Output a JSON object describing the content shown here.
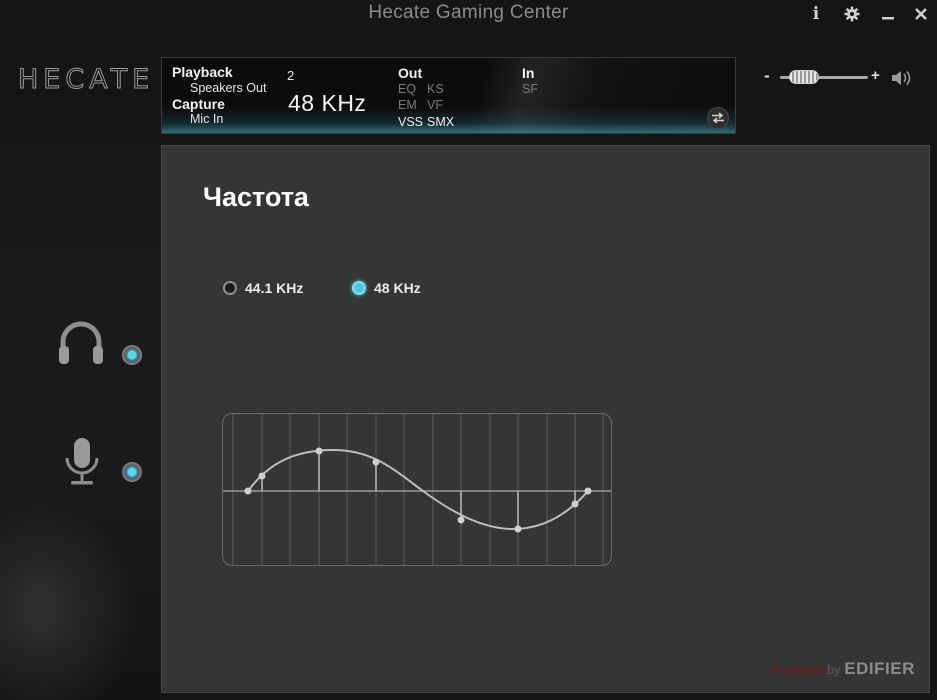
{
  "window": {
    "title": "Hecate Gaming Center",
    "buttons": {
      "info": "i"
    }
  },
  "logo": {
    "text": "HECATE"
  },
  "status": {
    "playback_label": "Playback",
    "playback_device": "Speakers Out",
    "capture_label": "Capture",
    "capture_device": "Mic In",
    "channels": "2",
    "sample_rate": "48 KHz",
    "out_label": "Out",
    "out_effects": [
      "EQ",
      "KS",
      "EM",
      "VF",
      "VSS",
      "SMX"
    ],
    "in_label": "In",
    "in_effects": [
      "SF"
    ]
  },
  "volume": {
    "minus": "-",
    "plus": "+",
    "level": 0.15
  },
  "main": {
    "title": "Частота",
    "options": [
      {
        "label": "44.1 KHz",
        "selected": false
      },
      {
        "label": "48 KHz",
        "selected": true
      }
    ]
  },
  "devices": {
    "headphones_active": true,
    "microphone_active": true
  },
  "footer": {
    "powered": "Powered",
    "by": "by",
    "brand": "EDIFIER"
  },
  "colors": {
    "accent": "#4cc6e2",
    "panel_bg": "#353535",
    "window_bg": "#151515"
  }
}
